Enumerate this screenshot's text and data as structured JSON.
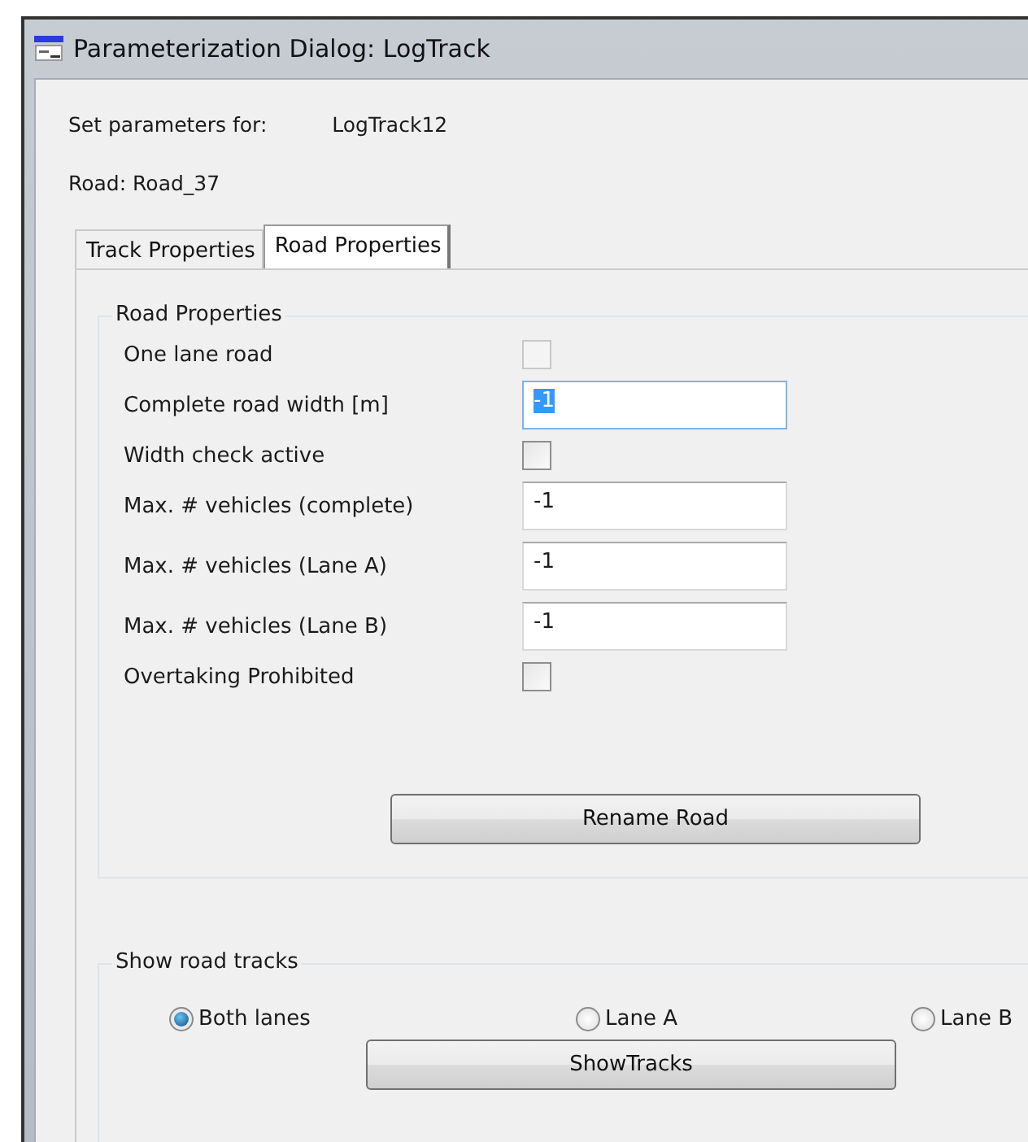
{
  "window": {
    "title": "Parameterization Dialog: LogTrack"
  },
  "set_parameters": {
    "label": "Set parameters for:",
    "value": "LogTrack12"
  },
  "road": {
    "label": "Road: Road_37"
  },
  "tabs": [
    {
      "label": "Track Properties",
      "selected": false
    },
    {
      "label": "Road Properties",
      "selected": true
    }
  ],
  "road_properties": {
    "title": "Road Properties",
    "fields": [
      {
        "kind": "checkbox",
        "label": "One lane road",
        "checked": false,
        "disabled": true
      },
      {
        "kind": "text",
        "label": "Complete road width [m]",
        "value": "-1",
        "selected": true
      },
      {
        "kind": "checkbox",
        "label": "Width check active",
        "checked": false,
        "disabled": false
      },
      {
        "kind": "text",
        "label": "Max. # vehicles (complete)",
        "value": "-1",
        "selected": false
      },
      {
        "kind": "text",
        "label": "Max. # vehicles (Lane A)",
        "value": "-1",
        "selected": false
      },
      {
        "kind": "text",
        "label": "Max. # vehicles (Lane B)",
        "value": "-1",
        "selected": false
      },
      {
        "kind": "checkbox",
        "label": "Overtaking Prohibited",
        "checked": false,
        "disabled": false
      }
    ],
    "button": "Rename Road"
  },
  "show_road_tracks": {
    "title": "Show road tracks",
    "options": [
      {
        "label": "Both lanes",
        "selected": true
      },
      {
        "label": "Lane A",
        "selected": false
      },
      {
        "label": "Lane B",
        "selected": false
      }
    ],
    "button": "ShowTracks"
  }
}
